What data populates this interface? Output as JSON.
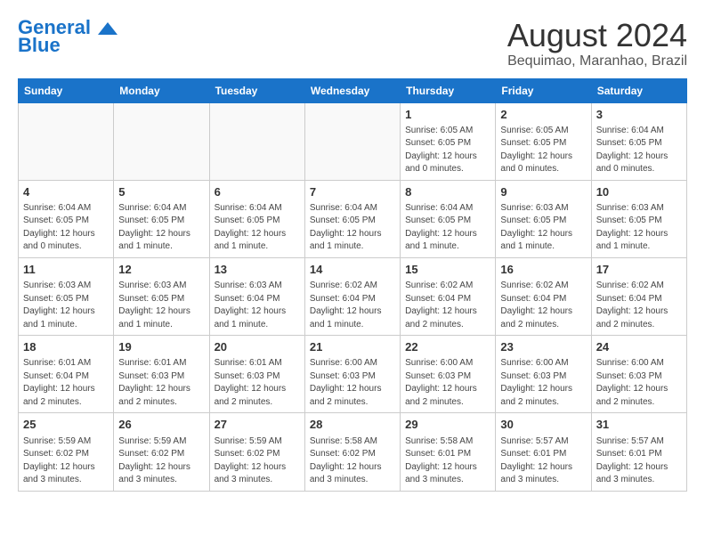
{
  "header": {
    "logo_line1": "General",
    "logo_line2": "Blue",
    "month_year": "August 2024",
    "location": "Bequimao, Maranhao, Brazil"
  },
  "days_of_week": [
    "Sunday",
    "Monday",
    "Tuesday",
    "Wednesday",
    "Thursday",
    "Friday",
    "Saturday"
  ],
  "weeks": [
    [
      {
        "day": "",
        "info": ""
      },
      {
        "day": "",
        "info": ""
      },
      {
        "day": "",
        "info": ""
      },
      {
        "day": "",
        "info": ""
      },
      {
        "day": "1",
        "info": "Sunrise: 6:05 AM\nSunset: 6:05 PM\nDaylight: 12 hours\nand 0 minutes."
      },
      {
        "day": "2",
        "info": "Sunrise: 6:05 AM\nSunset: 6:05 PM\nDaylight: 12 hours\nand 0 minutes."
      },
      {
        "day": "3",
        "info": "Sunrise: 6:04 AM\nSunset: 6:05 PM\nDaylight: 12 hours\nand 0 minutes."
      }
    ],
    [
      {
        "day": "4",
        "info": "Sunrise: 6:04 AM\nSunset: 6:05 PM\nDaylight: 12 hours\nand 0 minutes."
      },
      {
        "day": "5",
        "info": "Sunrise: 6:04 AM\nSunset: 6:05 PM\nDaylight: 12 hours\nand 1 minute."
      },
      {
        "day": "6",
        "info": "Sunrise: 6:04 AM\nSunset: 6:05 PM\nDaylight: 12 hours\nand 1 minute."
      },
      {
        "day": "7",
        "info": "Sunrise: 6:04 AM\nSunset: 6:05 PM\nDaylight: 12 hours\nand 1 minute."
      },
      {
        "day": "8",
        "info": "Sunrise: 6:04 AM\nSunset: 6:05 PM\nDaylight: 12 hours\nand 1 minute."
      },
      {
        "day": "9",
        "info": "Sunrise: 6:03 AM\nSunset: 6:05 PM\nDaylight: 12 hours\nand 1 minute."
      },
      {
        "day": "10",
        "info": "Sunrise: 6:03 AM\nSunset: 6:05 PM\nDaylight: 12 hours\nand 1 minute."
      }
    ],
    [
      {
        "day": "11",
        "info": "Sunrise: 6:03 AM\nSunset: 6:05 PM\nDaylight: 12 hours\nand 1 minute."
      },
      {
        "day": "12",
        "info": "Sunrise: 6:03 AM\nSunset: 6:05 PM\nDaylight: 12 hours\nand 1 minute."
      },
      {
        "day": "13",
        "info": "Sunrise: 6:03 AM\nSunset: 6:04 PM\nDaylight: 12 hours\nand 1 minute."
      },
      {
        "day": "14",
        "info": "Sunrise: 6:02 AM\nSunset: 6:04 PM\nDaylight: 12 hours\nand 1 minute."
      },
      {
        "day": "15",
        "info": "Sunrise: 6:02 AM\nSunset: 6:04 PM\nDaylight: 12 hours\nand 2 minutes."
      },
      {
        "day": "16",
        "info": "Sunrise: 6:02 AM\nSunset: 6:04 PM\nDaylight: 12 hours\nand 2 minutes."
      },
      {
        "day": "17",
        "info": "Sunrise: 6:02 AM\nSunset: 6:04 PM\nDaylight: 12 hours\nand 2 minutes."
      }
    ],
    [
      {
        "day": "18",
        "info": "Sunrise: 6:01 AM\nSunset: 6:04 PM\nDaylight: 12 hours\nand 2 minutes."
      },
      {
        "day": "19",
        "info": "Sunrise: 6:01 AM\nSunset: 6:03 PM\nDaylight: 12 hours\nand 2 minutes."
      },
      {
        "day": "20",
        "info": "Sunrise: 6:01 AM\nSunset: 6:03 PM\nDaylight: 12 hours\nand 2 minutes."
      },
      {
        "day": "21",
        "info": "Sunrise: 6:00 AM\nSunset: 6:03 PM\nDaylight: 12 hours\nand 2 minutes."
      },
      {
        "day": "22",
        "info": "Sunrise: 6:00 AM\nSunset: 6:03 PM\nDaylight: 12 hours\nand 2 minutes."
      },
      {
        "day": "23",
        "info": "Sunrise: 6:00 AM\nSunset: 6:03 PM\nDaylight: 12 hours\nand 2 minutes."
      },
      {
        "day": "24",
        "info": "Sunrise: 6:00 AM\nSunset: 6:03 PM\nDaylight: 12 hours\nand 2 minutes."
      }
    ],
    [
      {
        "day": "25",
        "info": "Sunrise: 5:59 AM\nSunset: 6:02 PM\nDaylight: 12 hours\nand 3 minutes."
      },
      {
        "day": "26",
        "info": "Sunrise: 5:59 AM\nSunset: 6:02 PM\nDaylight: 12 hours\nand 3 minutes."
      },
      {
        "day": "27",
        "info": "Sunrise: 5:59 AM\nSunset: 6:02 PM\nDaylight: 12 hours\nand 3 minutes."
      },
      {
        "day": "28",
        "info": "Sunrise: 5:58 AM\nSunset: 6:02 PM\nDaylight: 12 hours\nand 3 minutes."
      },
      {
        "day": "29",
        "info": "Sunrise: 5:58 AM\nSunset: 6:01 PM\nDaylight: 12 hours\nand 3 minutes."
      },
      {
        "day": "30",
        "info": "Sunrise: 5:57 AM\nSunset: 6:01 PM\nDaylight: 12 hours\nand 3 minutes."
      },
      {
        "day": "31",
        "info": "Sunrise: 5:57 AM\nSunset: 6:01 PM\nDaylight: 12 hours\nand 3 minutes."
      }
    ]
  ]
}
